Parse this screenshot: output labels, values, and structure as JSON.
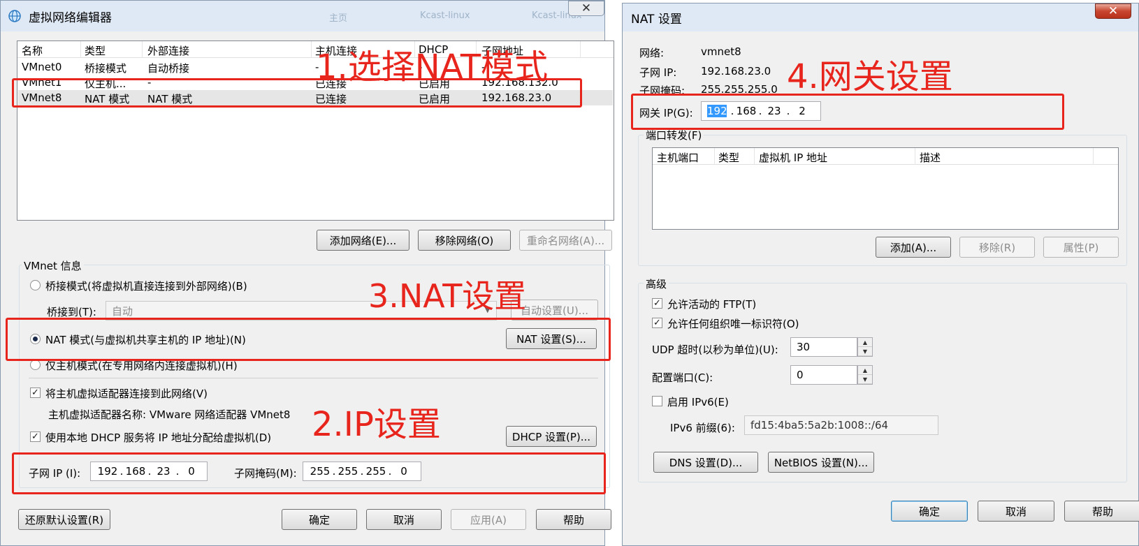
{
  "left_window": {
    "title": "虚拟网络编辑器",
    "background_tabs": [
      "主页",
      "Kcast-linux",
      "Kcast-linux"
    ],
    "close_glyph": "✕",
    "table": {
      "headers": [
        "名称",
        "类型",
        "外部连接",
        "主机连接",
        "DHCP",
        "子网地址"
      ],
      "rows": [
        [
          "VMnet0",
          "桥接模式",
          "自动桥接",
          "-",
          "-",
          "-"
        ],
        [
          "VMnet1",
          "仅主机...",
          "-",
          "已连接",
          "已启用",
          "192.168.132.0"
        ],
        [
          "VMnet8",
          "NAT 模式",
          "NAT 模式",
          "已连接",
          "已启用",
          "192.168.23.0"
        ]
      ],
      "selected_row": 2
    },
    "add_network_button": "添加网络(E)...",
    "remove_network_button": "移除网络(O)",
    "rename_network_button": "重命名网络(A)...",
    "vmnet_info": {
      "group_title": "VMnet 信息",
      "bridged_radio": "桥接模式(将虚拟机直接连接到外部网络)(B)",
      "bridged_to_label": "桥接到(T):",
      "bridged_to_value": "自动",
      "auto_settings_button": "自动设置(U)...",
      "nat_radio": "NAT 模式(与虚拟机共享主机的 IP 地址)(N)",
      "nat_settings_button": "NAT 设置(S)...",
      "host_only_radio": "仅主机模式(在专用网络内连接虚拟机)(H)",
      "connect_adapter_checkbox": "将主机虚拟适配器连接到此网络(V)",
      "adapter_name_text": "主机虚拟适配器名称: VMware 网络适配器 VMnet8",
      "dhcp_checkbox": "使用本地 DHCP 服务将 IP 地址分配给虚拟机(D)",
      "dhcp_settings_button": "DHCP 设置(P)...",
      "subnet_ip_label": "子网 IP (I):",
      "subnet_ip": [
        "192",
        "168",
        "23",
        "0"
      ],
      "subnet_mask_label": "子网掩码(M):",
      "subnet_mask": [
        "255",
        "255",
        "255",
        "0"
      ]
    },
    "restore_defaults_button": "还原默认设置(R)",
    "ok_button": "确定",
    "cancel_button": "取消",
    "apply_button": "应用(A)",
    "help_button": "帮助"
  },
  "right_window": {
    "title": "NAT 设置",
    "close_glyph": "✕",
    "network_label": "网络:",
    "network_value": "vmnet8",
    "subnet_ip_label": "子网 IP:",
    "subnet_ip_value": "192.168.23.0",
    "subnet_mask_label": "子网掩码:",
    "subnet_mask_value": "255.255.255.0",
    "gateway_label": "网关 IP(G):",
    "gateway_ip": [
      "192",
      "168",
      "23",
      "2"
    ],
    "port_forwarding": {
      "group_title": "端口转发(F)",
      "headers": [
        "主机端口",
        "类型",
        "虚拟机 IP 地址",
        "描述"
      ],
      "add_button": "添加(A)...",
      "remove_button": "移除(R)",
      "properties_button": "属性(P)"
    },
    "advanced": {
      "group_title": "高级",
      "allow_ftp_checkbox": "允许活动的 FTP(T)",
      "allow_oui_checkbox": "允许任何组织唯一标识符(O)",
      "udp_timeout_label": "UDP 超时(以秒为单位)(U):",
      "udp_timeout_value": "30",
      "config_port_label": "配置端口(C):",
      "config_port_value": "0",
      "enable_ipv6_checkbox": "启用 IPv6(E)",
      "ipv6_prefix_label": "IPv6 前缀(6):",
      "ipv6_prefix_value": "fd15:4ba5:5a2b:1008::/64"
    },
    "dns_button": "DNS 设置(D)...",
    "netbios_button": "NetBIOS 设置(N)...",
    "ok_button": "确定",
    "cancel_button": "取消",
    "help_button": "帮助"
  },
  "annotations": {
    "step1": "1.选择NAT模式",
    "step2": "2.IP设置",
    "step3": "3.NAT设置",
    "step4": "4.网关设置"
  },
  "colors": {
    "annotation_red": "#e8251d",
    "dialog_bg": "#f0f0f0",
    "titlebar_bg": "#dfe9f5",
    "selection_blue": "#3399ff"
  }
}
